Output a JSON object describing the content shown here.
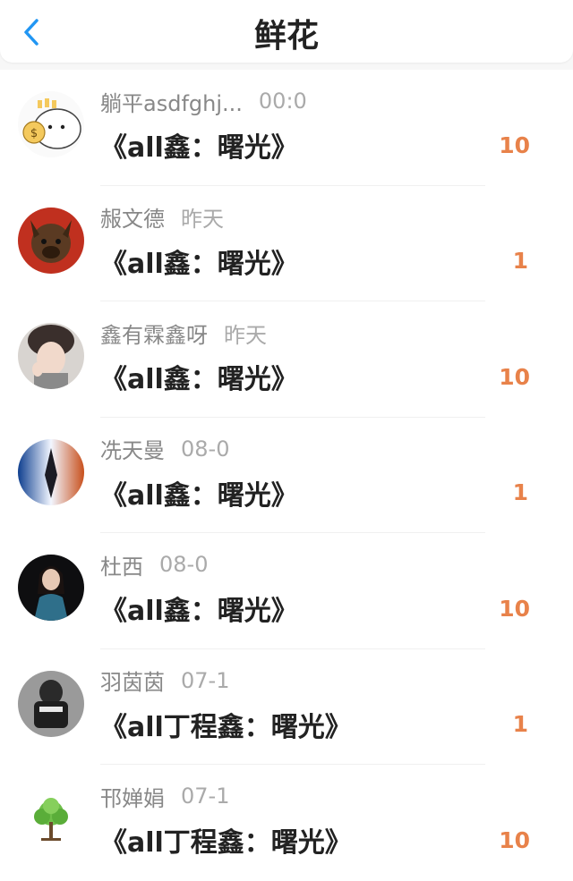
{
  "header": {
    "title": "鲜花",
    "back_icon": "chevron-left-icon",
    "accent": "#2196f3"
  },
  "count_color": "#e8824a",
  "items": [
    {
      "name": "躺平asdfghj...",
      "time": "00:0",
      "work": "《all鑫：曙光》",
      "count": "10",
      "avatar": "cartoon-money-bag"
    },
    {
      "name": "赧文德",
      "time": "昨天",
      "work": "《all鑫：曙光》",
      "count": "1",
      "avatar": "dog-photo"
    },
    {
      "name": "鑫有霖鑫呀",
      "time": "昨天",
      "work": "《all鑫：曙光》",
      "count": "10",
      "avatar": "person-photo"
    },
    {
      "name": "冼天曼",
      "time": "08-0",
      "work": "《all鑫：曙光》",
      "count": "1",
      "avatar": "fantasy-art"
    },
    {
      "name": "杜西",
      "time": "08-0",
      "work": "《all鑫：曙光》",
      "count": "10",
      "avatar": "person-dark"
    },
    {
      "name": "羽茵茵",
      "time": "07-1",
      "work": "《all丁程鑫：曙光》",
      "count": "1",
      "avatar": "person-gray"
    },
    {
      "name": "邗婵娟",
      "time": "07-1",
      "work": "《all丁程鑫：曙光》",
      "count": "10",
      "avatar": "green-tree"
    }
  ]
}
